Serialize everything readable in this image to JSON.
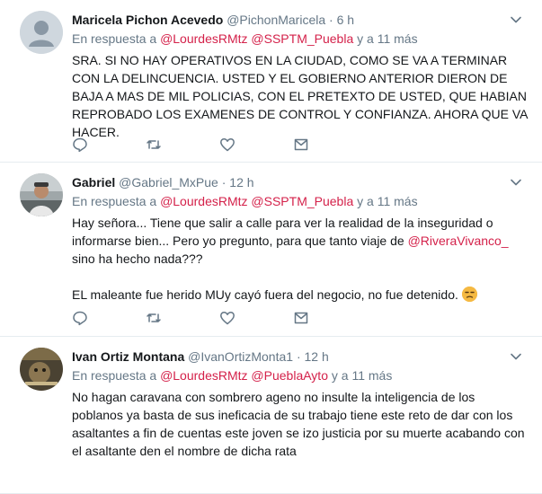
{
  "tweets": [
    {
      "author_name": "Maricela Pichon Acevedo",
      "handle": "@PichonMaricela",
      "separator": "·",
      "time": "6 h",
      "reply_prefix": "En respuesta a",
      "reply_mention_1": "@LourdesRMtz",
      "reply_mention_2": "@SSPTM_Puebla",
      "reply_suffix": "y a 11 más",
      "text": "SRA. SI NO HAY OPERATIVOS EN LA CIUDAD, COMO SE VA A TERMINAR CON LA DELINCUENCIA. USTED Y EL GOBIERNO ANTERIOR DIERON DE BAJA A MAS DE MIL POLICIAS, CON EL PRETEXTO DE USTED, QUE HABIAN REPROBADO LOS EXAMENES DE CONTROL Y CONFIANZA. AHORA QUE VA HACER."
    },
    {
      "author_name": "Gabriel",
      "handle": "@Gabriel_MxPue",
      "separator": "·",
      "time": "12 h",
      "reply_prefix": "En respuesta a",
      "reply_mention_1": "@LourdesRMtz",
      "reply_mention_2": "@SSPTM_Puebla",
      "reply_suffix": "y a 11 más",
      "text_part_1": "Hay señora... Tiene que salir a calle para ver la realidad de la inseguridad o informarse bien... Pero yo pregunto, para que tanto viaje de ",
      "text_mention": "@RiveraVivanco_",
      "text_part_2": " sino ha hecho nada???",
      "text_para_2": "EL maleante fue herido MUy cayó fuera del negocio, no fue detenido."
    },
    {
      "author_name": "Ivan Ortiz Montana",
      "handle": "@IvanOrtizMonta1",
      "separator": "·",
      "time": "12 h",
      "reply_prefix": "En respuesta a",
      "reply_mention_1": "@LourdesRMtz",
      "reply_mention_2": "@PueblaAyto",
      "reply_suffix": "y a 11 más",
      "text": "No hagan caravana con sombrero ageno no insulte la inteligencia de los poblanos ya basta de sus ineficacia de su trabajo tiene este reto de dar con los asaltantes a fin de cuentas este joven se izo justicia por su muerte acabando con el asaltante den el nombre de dicha rata"
    }
  ],
  "icons": [
    "chevron-down-icon",
    "reply-icon",
    "retweet-icon",
    "like-icon",
    "direct-message-icon",
    "unamused-face-emoji"
  ],
  "colors": {
    "mention": "#d4214a",
    "secondary_text": "#657786",
    "divider": "#e6ecf0"
  }
}
